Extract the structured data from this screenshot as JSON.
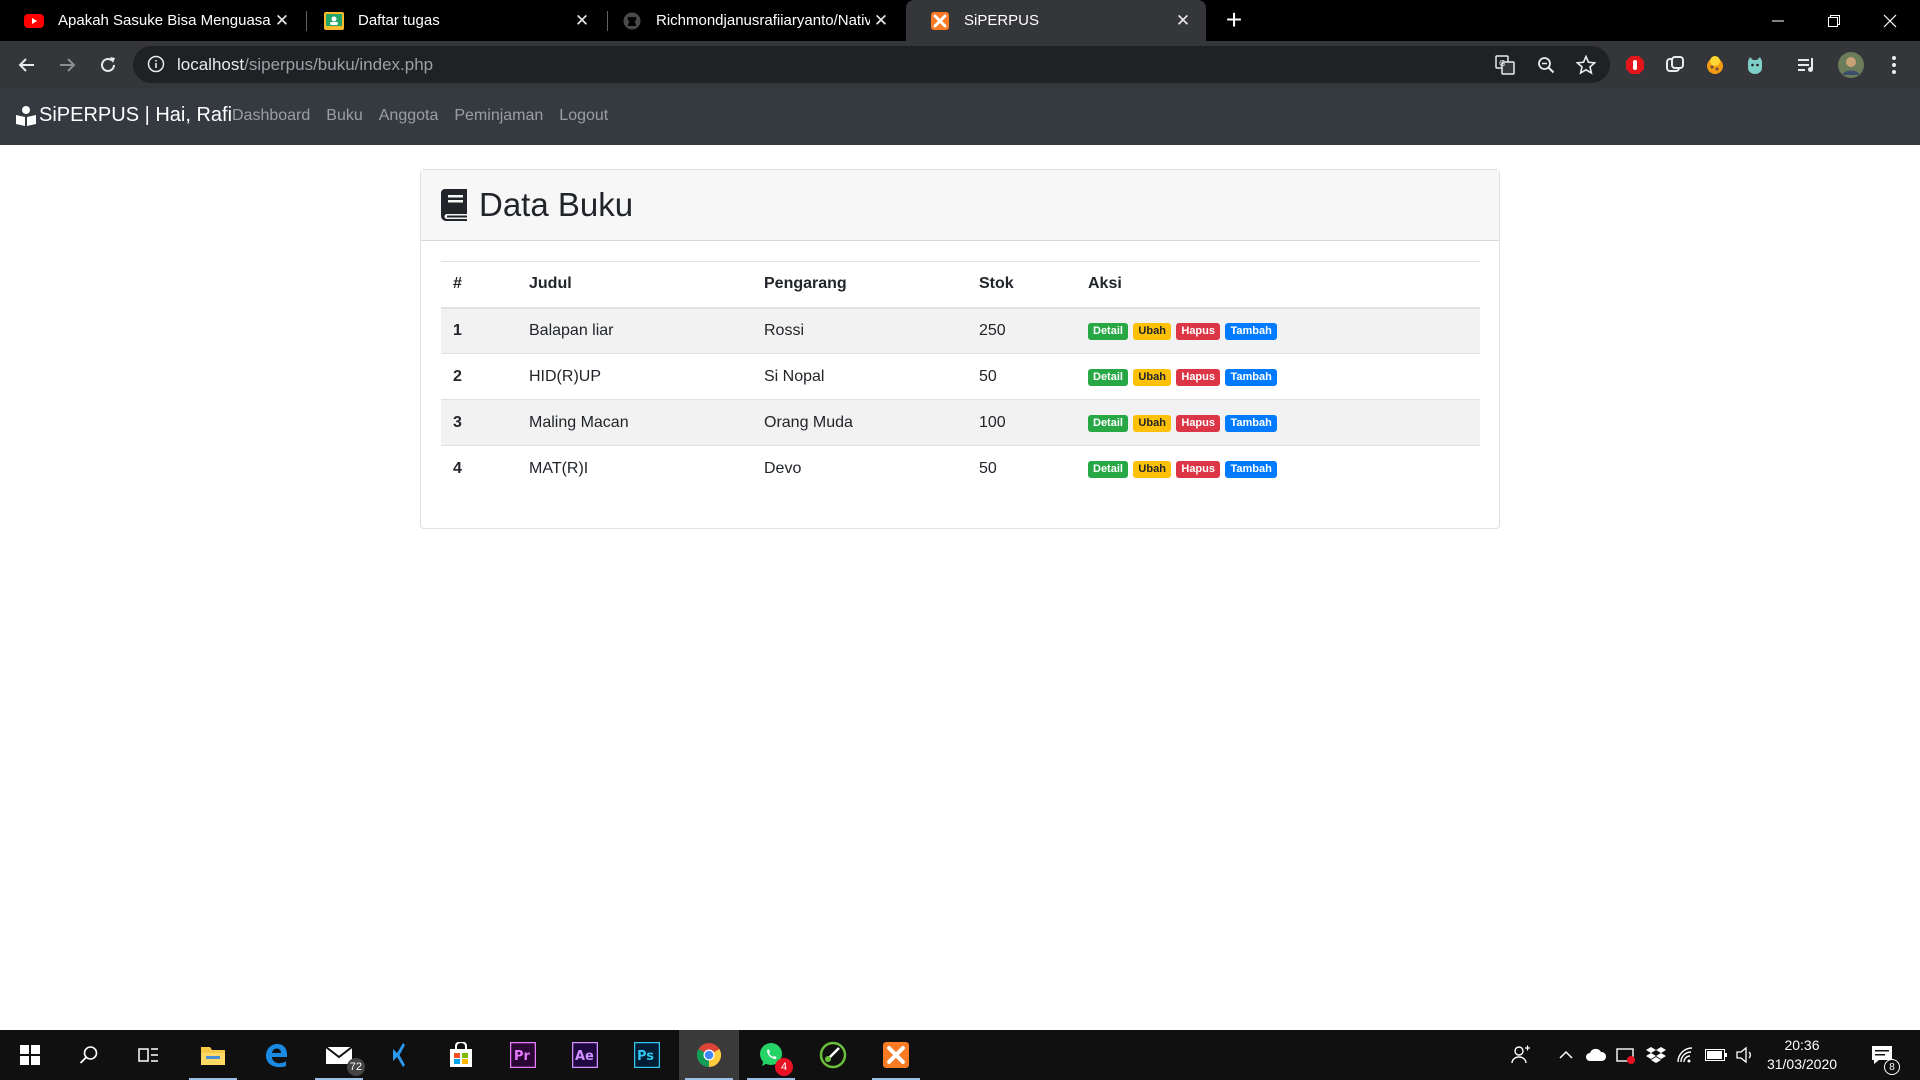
{
  "browser": {
    "tabs": [
      {
        "title": "Apakah Sasuke Bisa Menguasai S",
        "icon": "youtube-icon",
        "active": false
      },
      {
        "title": "Daftar tugas",
        "icon": "classroom-icon",
        "active": false
      },
      {
        "title": "Richmondjanusrafiiaryanto/Nativ",
        "icon": "github-icon",
        "active": false
      },
      {
        "title": "SiPERPUS",
        "icon": "xampp-icon",
        "active": true
      }
    ],
    "close_symbol": "✕",
    "new_tab_symbol": "+",
    "url_host": "localhost",
    "url_path": "/siperpus/buku/index.php"
  },
  "navbar": {
    "brand": "SiPERPUS | Hai, Rafi",
    "links": [
      "Dashboard",
      "Buku",
      "Anggota",
      "Peminjaman",
      "Logout"
    ]
  },
  "page": {
    "title": "Data Buku",
    "table": {
      "headers": [
        "#",
        "Judul",
        "Pengarang",
        "Stok",
        "Aksi"
      ],
      "rows": [
        {
          "no": "1",
          "judul": "Balapan liar",
          "pengarang": "Rossi",
          "stok": "250"
        },
        {
          "no": "2",
          "judul": "HID(R)UP",
          "pengarang": "Si Nopal",
          "stok": "50"
        },
        {
          "no": "3",
          "judul": "Maling Macan",
          "pengarang": "Orang Muda",
          "stok": "100"
        },
        {
          "no": "4",
          "judul": "MAT(R)I",
          "pengarang": "Devo",
          "stok": "50"
        }
      ],
      "actions": [
        "Detail",
        "Ubah",
        "Hapus",
        "Tambah"
      ]
    }
  },
  "taskbar": {
    "mail_badge": "72",
    "whatsapp_badge": "4",
    "notification_badge": "8",
    "time": "20:36",
    "date": "31/03/2020"
  },
  "colors": {
    "navbar_bg": "#343a40",
    "success": "#28a745",
    "warning": "#ffc107",
    "danger": "#dc3545",
    "primary": "#007bff"
  }
}
